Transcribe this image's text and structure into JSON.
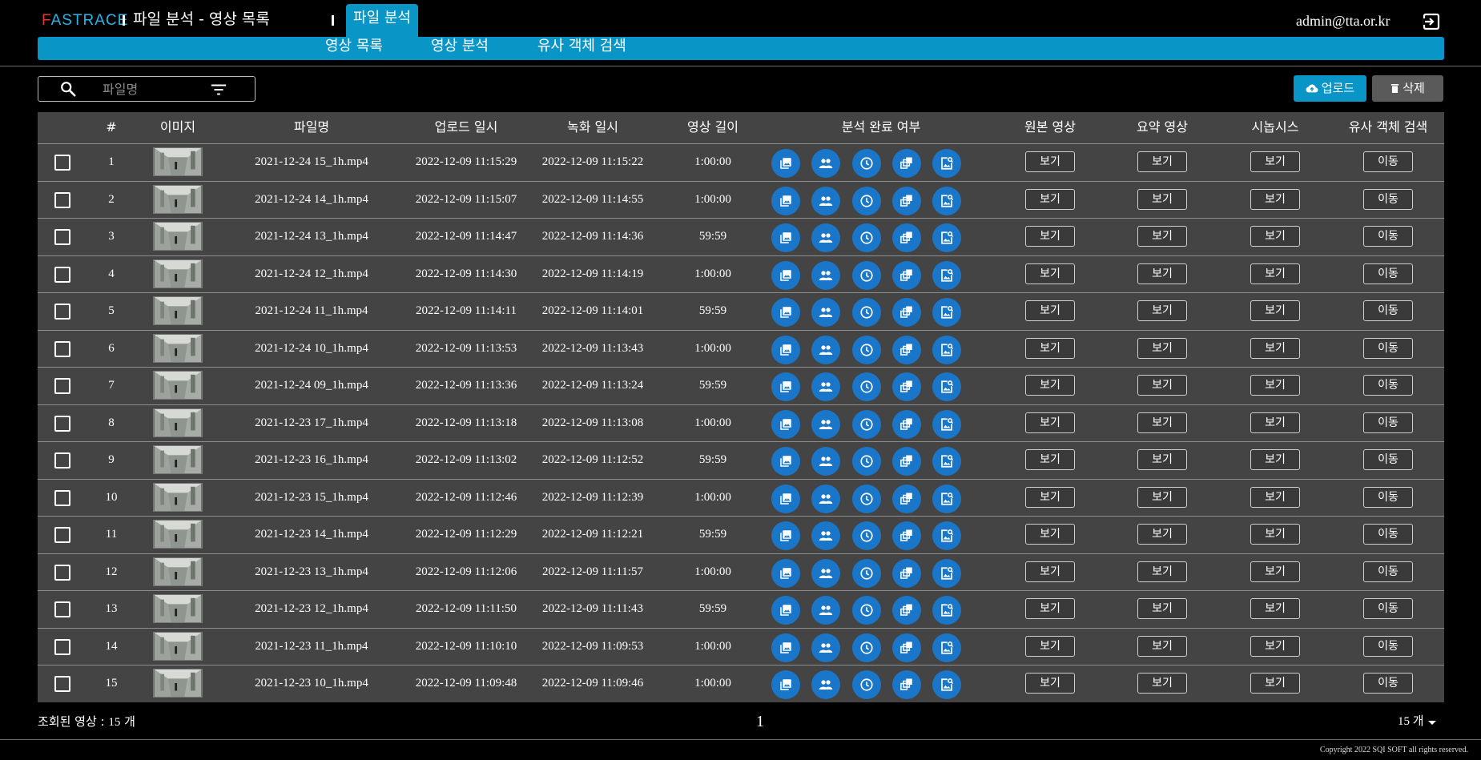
{
  "app": {
    "logo_first": "F",
    "logo_rest": "ASTRACE",
    "page_title": "파일 분석 - 영상 목록",
    "active_tab": "파일 분석",
    "user": "admin@tta.or.kr",
    "logout_icon": "logout-icon"
  },
  "subnav": [
    "영상 목록",
    "영상 분석",
    "유사 객체 검색"
  ],
  "search": {
    "placeholder": "파일명",
    "icon": "search-icon",
    "filter_icon": "filter-icon"
  },
  "actions": {
    "upload": "업로드",
    "delete": "삭제"
  },
  "columns": [
    "#",
    "이미지",
    "파일명",
    "업로드 일시",
    "녹화 일시",
    "영상 길이",
    "분석 완료 여부",
    "원본 영상",
    "요약 영상",
    "시놉시스",
    "유사 객체 검색"
  ],
  "analysis_icons": [
    "image-icon",
    "people-icon",
    "clock-icon",
    "layers-icon",
    "image-search-icon"
  ],
  "labels": {
    "view": "보기",
    "move": "이동"
  },
  "rows": [
    {
      "no": "1",
      "file": "2021-12-24 15_1h.mp4",
      "upload": "2022-12-09 11:15:29",
      "record": "2022-12-09 11:15:22",
      "length": "1:00:00"
    },
    {
      "no": "2",
      "file": "2021-12-24 14_1h.mp4",
      "upload": "2022-12-09 11:15:07",
      "record": "2022-12-09 11:14:55",
      "length": "1:00:00"
    },
    {
      "no": "3",
      "file": "2021-12-24 13_1h.mp4",
      "upload": "2022-12-09 11:14:47",
      "record": "2022-12-09 11:14:36",
      "length": "59:59"
    },
    {
      "no": "4",
      "file": "2021-12-24 12_1h.mp4",
      "upload": "2022-12-09 11:14:30",
      "record": "2022-12-09 11:14:19",
      "length": "1:00:00"
    },
    {
      "no": "5",
      "file": "2021-12-24 11_1h.mp4",
      "upload": "2022-12-09 11:14:11",
      "record": "2022-12-09 11:14:01",
      "length": "59:59"
    },
    {
      "no": "6",
      "file": "2021-12-24 10_1h.mp4",
      "upload": "2022-12-09 11:13:53",
      "record": "2022-12-09 11:13:43",
      "length": "1:00:00"
    },
    {
      "no": "7",
      "file": "2021-12-24 09_1h.mp4",
      "upload": "2022-12-09 11:13:36",
      "record": "2022-12-09 11:13:24",
      "length": "59:59"
    },
    {
      "no": "8",
      "file": "2021-12-23 17_1h.mp4",
      "upload": "2022-12-09 11:13:18",
      "record": "2022-12-09 11:13:08",
      "length": "1:00:00"
    },
    {
      "no": "9",
      "file": "2021-12-23 16_1h.mp4",
      "upload": "2022-12-09 11:13:02",
      "record": "2022-12-09 11:12:52",
      "length": "59:59"
    },
    {
      "no": "10",
      "file": "2021-12-23 15_1h.mp4",
      "upload": "2022-12-09 11:12:46",
      "record": "2022-12-09 11:12:39",
      "length": "1:00:00"
    },
    {
      "no": "11",
      "file": "2021-12-23 14_1h.mp4",
      "upload": "2022-12-09 11:12:29",
      "record": "2022-12-09 11:12:21",
      "length": "59:59"
    },
    {
      "no": "12",
      "file": "2021-12-23 13_1h.mp4",
      "upload": "2022-12-09 11:12:06",
      "record": "2022-12-09 11:11:57",
      "length": "1:00:00"
    },
    {
      "no": "13",
      "file": "2021-12-23 12_1h.mp4",
      "upload": "2022-12-09 11:11:50",
      "record": "2022-12-09 11:11:43",
      "length": "59:59"
    },
    {
      "no": "14",
      "file": "2021-12-23 11_1h.mp4",
      "upload": "2022-12-09 11:10:10",
      "record": "2022-12-09 11:09:53",
      "length": "1:00:00"
    },
    {
      "no": "15",
      "file": "2021-12-23 10_1h.mp4",
      "upload": "2022-12-09 11:09:48",
      "record": "2022-12-09 11:09:46",
      "length": "1:00:00"
    }
  ],
  "footer": {
    "count_label": "조회된 영상 : ",
    "count_value": "15",
    "count_unit": " 개",
    "page": "1",
    "per_page": "15 개",
    "copyright": "Copyright 2022 SQI SOFT all rights reserved."
  },
  "colors": {
    "accent": "#0a95c7",
    "icon_circle": "#1976c9",
    "table_bg": "#444444",
    "delete_bg": "#5a5a5a",
    "logo_red": "#e8342a",
    "logo_blue": "#2ab2e6"
  }
}
